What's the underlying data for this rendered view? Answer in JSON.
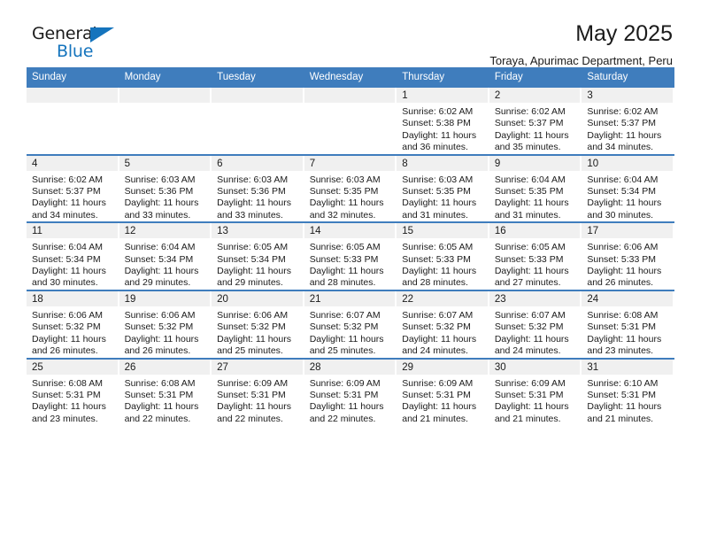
{
  "brand": {
    "name_top": "General",
    "name_bottom": "Blue",
    "triangle_color": "#1574bd",
    "text_color": "#1b1b1b"
  },
  "header": {
    "title": "May 2025",
    "subtitle": "Toraya, Apurimac Department, Peru"
  },
  "theme": {
    "header_blue": "#3f7dbd",
    "daynum_band": "#f0f0f0",
    "text": "#1b1b1b",
    "page_background": "#ffffff"
  },
  "weekday_headers": [
    "Sunday",
    "Monday",
    "Tuesday",
    "Wednesday",
    "Thursday",
    "Friday",
    "Saturday"
  ],
  "weeks": [
    [
      {
        "day": "",
        "sunrise": "",
        "sunset": "",
        "daylight1": "",
        "daylight2": ""
      },
      {
        "day": "",
        "sunrise": "",
        "sunset": "",
        "daylight1": "",
        "daylight2": ""
      },
      {
        "day": "",
        "sunrise": "",
        "sunset": "",
        "daylight1": "",
        "daylight2": ""
      },
      {
        "day": "",
        "sunrise": "",
        "sunset": "",
        "daylight1": "",
        "daylight2": ""
      },
      {
        "day": "1",
        "sunrise": "Sunrise: 6:02 AM",
        "sunset": "Sunset: 5:38 PM",
        "daylight1": "Daylight: 11 hours",
        "daylight2": "and 36 minutes."
      },
      {
        "day": "2",
        "sunrise": "Sunrise: 6:02 AM",
        "sunset": "Sunset: 5:37 PM",
        "daylight1": "Daylight: 11 hours",
        "daylight2": "and 35 minutes."
      },
      {
        "day": "3",
        "sunrise": "Sunrise: 6:02 AM",
        "sunset": "Sunset: 5:37 PM",
        "daylight1": "Daylight: 11 hours",
        "daylight2": "and 34 minutes."
      }
    ],
    [
      {
        "day": "4",
        "sunrise": "Sunrise: 6:02 AM",
        "sunset": "Sunset: 5:37 PM",
        "daylight1": "Daylight: 11 hours",
        "daylight2": "and 34 minutes."
      },
      {
        "day": "5",
        "sunrise": "Sunrise: 6:03 AM",
        "sunset": "Sunset: 5:36 PM",
        "daylight1": "Daylight: 11 hours",
        "daylight2": "and 33 minutes."
      },
      {
        "day": "6",
        "sunrise": "Sunrise: 6:03 AM",
        "sunset": "Sunset: 5:36 PM",
        "daylight1": "Daylight: 11 hours",
        "daylight2": "and 33 minutes."
      },
      {
        "day": "7",
        "sunrise": "Sunrise: 6:03 AM",
        "sunset": "Sunset: 5:35 PM",
        "daylight1": "Daylight: 11 hours",
        "daylight2": "and 32 minutes."
      },
      {
        "day": "8",
        "sunrise": "Sunrise: 6:03 AM",
        "sunset": "Sunset: 5:35 PM",
        "daylight1": "Daylight: 11 hours",
        "daylight2": "and 31 minutes."
      },
      {
        "day": "9",
        "sunrise": "Sunrise: 6:04 AM",
        "sunset": "Sunset: 5:35 PM",
        "daylight1": "Daylight: 11 hours",
        "daylight2": "and 31 minutes."
      },
      {
        "day": "10",
        "sunrise": "Sunrise: 6:04 AM",
        "sunset": "Sunset: 5:34 PM",
        "daylight1": "Daylight: 11 hours",
        "daylight2": "and 30 minutes."
      }
    ],
    [
      {
        "day": "11",
        "sunrise": "Sunrise: 6:04 AM",
        "sunset": "Sunset: 5:34 PM",
        "daylight1": "Daylight: 11 hours",
        "daylight2": "and 30 minutes."
      },
      {
        "day": "12",
        "sunrise": "Sunrise: 6:04 AM",
        "sunset": "Sunset: 5:34 PM",
        "daylight1": "Daylight: 11 hours",
        "daylight2": "and 29 minutes."
      },
      {
        "day": "13",
        "sunrise": "Sunrise: 6:05 AM",
        "sunset": "Sunset: 5:34 PM",
        "daylight1": "Daylight: 11 hours",
        "daylight2": "and 29 minutes."
      },
      {
        "day": "14",
        "sunrise": "Sunrise: 6:05 AM",
        "sunset": "Sunset: 5:33 PM",
        "daylight1": "Daylight: 11 hours",
        "daylight2": "and 28 minutes."
      },
      {
        "day": "15",
        "sunrise": "Sunrise: 6:05 AM",
        "sunset": "Sunset: 5:33 PM",
        "daylight1": "Daylight: 11 hours",
        "daylight2": "and 28 minutes."
      },
      {
        "day": "16",
        "sunrise": "Sunrise: 6:05 AM",
        "sunset": "Sunset: 5:33 PM",
        "daylight1": "Daylight: 11 hours",
        "daylight2": "and 27 minutes."
      },
      {
        "day": "17",
        "sunrise": "Sunrise: 6:06 AM",
        "sunset": "Sunset: 5:33 PM",
        "daylight1": "Daylight: 11 hours",
        "daylight2": "and 26 minutes."
      }
    ],
    [
      {
        "day": "18",
        "sunrise": "Sunrise: 6:06 AM",
        "sunset": "Sunset: 5:32 PM",
        "daylight1": "Daylight: 11 hours",
        "daylight2": "and 26 minutes."
      },
      {
        "day": "19",
        "sunrise": "Sunrise: 6:06 AM",
        "sunset": "Sunset: 5:32 PM",
        "daylight1": "Daylight: 11 hours",
        "daylight2": "and 26 minutes."
      },
      {
        "day": "20",
        "sunrise": "Sunrise: 6:06 AM",
        "sunset": "Sunset: 5:32 PM",
        "daylight1": "Daylight: 11 hours",
        "daylight2": "and 25 minutes."
      },
      {
        "day": "21",
        "sunrise": "Sunrise: 6:07 AM",
        "sunset": "Sunset: 5:32 PM",
        "daylight1": "Daylight: 11 hours",
        "daylight2": "and 25 minutes."
      },
      {
        "day": "22",
        "sunrise": "Sunrise: 6:07 AM",
        "sunset": "Sunset: 5:32 PM",
        "daylight1": "Daylight: 11 hours",
        "daylight2": "and 24 minutes."
      },
      {
        "day": "23",
        "sunrise": "Sunrise: 6:07 AM",
        "sunset": "Sunset: 5:32 PM",
        "daylight1": "Daylight: 11 hours",
        "daylight2": "and 24 minutes."
      },
      {
        "day": "24",
        "sunrise": "Sunrise: 6:08 AM",
        "sunset": "Sunset: 5:31 PM",
        "daylight1": "Daylight: 11 hours",
        "daylight2": "and 23 minutes."
      }
    ],
    [
      {
        "day": "25",
        "sunrise": "Sunrise: 6:08 AM",
        "sunset": "Sunset: 5:31 PM",
        "daylight1": "Daylight: 11 hours",
        "daylight2": "and 23 minutes."
      },
      {
        "day": "26",
        "sunrise": "Sunrise: 6:08 AM",
        "sunset": "Sunset: 5:31 PM",
        "daylight1": "Daylight: 11 hours",
        "daylight2": "and 22 minutes."
      },
      {
        "day": "27",
        "sunrise": "Sunrise: 6:09 AM",
        "sunset": "Sunset: 5:31 PM",
        "daylight1": "Daylight: 11 hours",
        "daylight2": "and 22 minutes."
      },
      {
        "day": "28",
        "sunrise": "Sunrise: 6:09 AM",
        "sunset": "Sunset: 5:31 PM",
        "daylight1": "Daylight: 11 hours",
        "daylight2": "and 22 minutes."
      },
      {
        "day": "29",
        "sunrise": "Sunrise: 6:09 AM",
        "sunset": "Sunset: 5:31 PM",
        "daylight1": "Daylight: 11 hours",
        "daylight2": "and 21 minutes."
      },
      {
        "day": "30",
        "sunrise": "Sunrise: 6:09 AM",
        "sunset": "Sunset: 5:31 PM",
        "daylight1": "Daylight: 11 hours",
        "daylight2": "and 21 minutes."
      },
      {
        "day": "31",
        "sunrise": "Sunrise: 6:10 AM",
        "sunset": "Sunset: 5:31 PM",
        "daylight1": "Daylight: 11 hours",
        "daylight2": "and 21 minutes."
      }
    ]
  ]
}
